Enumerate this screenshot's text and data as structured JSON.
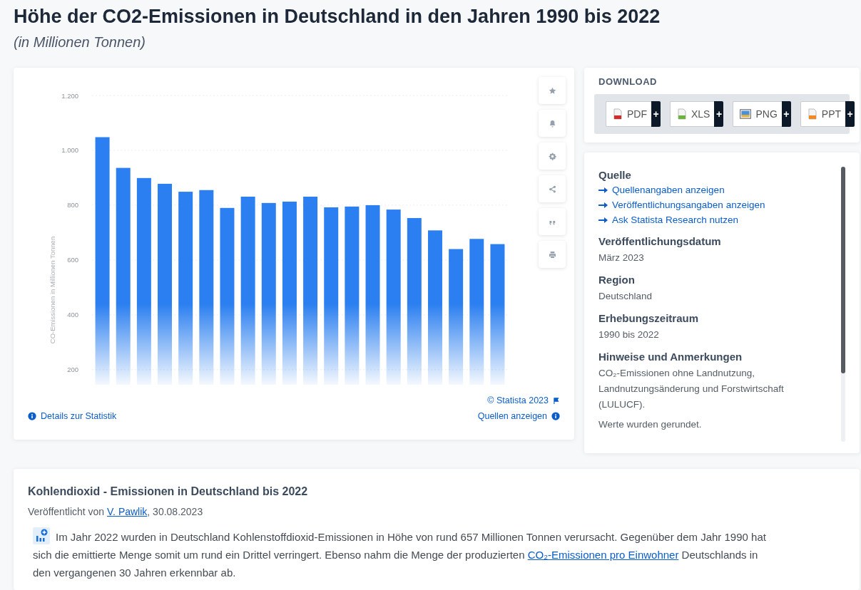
{
  "header": {
    "title": "Höhe der CO2-Emissionen in Deutschland in den Jahren 1990 bis 2022",
    "subtitle": "(in Millionen Tonnen)"
  },
  "chart_card": {
    "chart_data": {
      "type": "bar",
      "ylabel": "CO-Emissionen in Millionen Tonnen",
      "values": [
        1048,
        936,
        899,
        878,
        849,
        855,
        790,
        831,
        808,
        813,
        831,
        792,
        795,
        800,
        784,
        753,
        708,
        640,
        677,
        658
      ],
      "ylim": [
        145,
        1200
      ],
      "grid": true,
      "yticks": [
        {
          "value": 200,
          "label": "200"
        },
        {
          "value": 400,
          "label": "400"
        },
        {
          "value": 600,
          "label": "600"
        },
        {
          "value": 800,
          "label": "800"
        },
        {
          "value": 1000,
          "label": "1.000"
        },
        {
          "value": 1200,
          "label": "1.200"
        }
      ]
    },
    "tools": [
      {
        "kind": "star"
      },
      {
        "kind": "bell"
      },
      {
        "kind": "gear"
      },
      {
        "kind": "share"
      },
      {
        "kind": "quote"
      },
      {
        "kind": "print"
      }
    ],
    "copyright": "© Statista 2023",
    "details_link": "Details zur Statistik",
    "sources_link": "Quellen anzeigen"
  },
  "download": {
    "title": "DOWNLOAD",
    "buttons": [
      {
        "label": "PDF",
        "kind": "pdf",
        "plus": "+"
      },
      {
        "label": "XLS",
        "kind": "xls",
        "plus": "+"
      },
      {
        "label": "PNG",
        "kind": "png",
        "plus": "+"
      },
      {
        "label": "PPT",
        "kind": "ppt",
        "plus": "+"
      }
    ]
  },
  "info": {
    "sections": [
      {
        "heading": "Quelle",
        "links": [
          "Quellenangaben anzeigen",
          "Veröffentlichungsangaben anzeigen",
          "Ask Statista Research nutzen"
        ]
      },
      {
        "heading": "Veröffentlichungsdatum",
        "text": "März 2023"
      },
      {
        "heading": "Region",
        "text": "Deutschland"
      },
      {
        "heading": "Erhebungszeitraum",
        "text": "1990 bis 2022"
      },
      {
        "heading": "Hinweise und Anmerkungen",
        "text": "CO₂-Emissionen ohne Landnutzung, Landnutzungsänderung und Forstwirtschaft (LULUCF).",
        "text2": "Werte wurden gerundet."
      }
    ]
  },
  "article": {
    "title": "Kohlendioxid - Emissionen in Deutschland bis 2022",
    "byline": [
      {
        "kind": "text",
        "text": "Veröffentlicht von "
      },
      {
        "kind": "link",
        "text": "V. Pawlik"
      },
      {
        "kind": "text",
        "text": ", 30.08.2023"
      }
    ],
    "body": [
      {
        "kind": "text",
        "text": "Im Jahr 2022 wurden in Deutschland Kohlenstoffdioxid-Emissionen in Höhe von rund 657 Millionen Tonnen verursacht. Gegenüber dem Jahr 1990 hat sich die emittierte Menge somit um rund ein Drittel verringert. Ebenso nahm die Menge der produzierten "
      },
      {
        "kind": "link",
        "text": "CO₂-Emissionen pro Einwohner"
      },
      {
        "kind": "text",
        "text": " Deutschlands in den vergangenen 30 Jahren erkennbar ab."
      }
    ]
  }
}
